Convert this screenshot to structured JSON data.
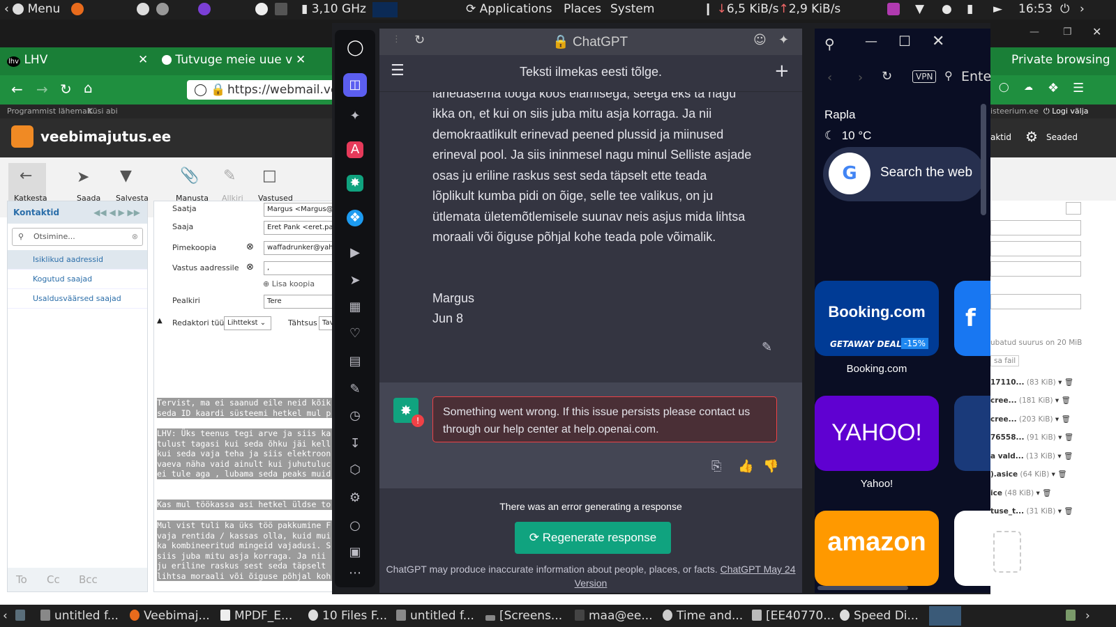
{
  "top_panel": {
    "menu": "Menu",
    "cpu": "3,10 GHz",
    "applications": "Applications",
    "places": "Places",
    "system": "System",
    "net_down": "6,5 KiB/s",
    "net_up": "2,9 KiB/s",
    "clock": "16:53"
  },
  "mail_browser": {
    "tabs": [
      "LHV",
      "Tutvuge meie uue v"
    ],
    "url": "https://webmail.ve",
    "private_browsing": "Private browsing",
    "topbar_links": [
      "Programmist lähemalt",
      "Küsi abi"
    ],
    "topbar_right": [
      "isteerium.ee",
      "Logi välja"
    ],
    "brand": "veebimajutus.ee",
    "brand_right": [
      "aktid",
      "Seaded"
    ],
    "toolbar": [
      "Katkesta",
      "Saada",
      "Salvesta",
      "Manusta",
      "Allkiri",
      "Vastused"
    ],
    "contacts": {
      "title": "Kontaktid",
      "search_placeholder": "Otsimine...",
      "items": [
        "Isiklikud aadressid",
        "Kogutud saajad",
        "Usaldusväärsed saajad"
      ],
      "bottom": [
        "To",
        "Cc",
        "Bcc"
      ]
    },
    "compose": {
      "fields": [
        {
          "label": "Saatja",
          "value": "Margus <Margus@"
        },
        {
          "label": "Saaja",
          "value": "Eret Pank <eret.pan"
        },
        {
          "label": "Pimekoopia",
          "value": "waffadrunker@yaho"
        },
        {
          "label": "Vastus aadressile",
          "value": ","
        },
        {
          "label": "Pealkiri",
          "value": "Tere"
        }
      ],
      "add_copy": "Lisa koopia",
      "editor_type_label": "Redaktori tüüp",
      "editor_type_value": "Lihttekst",
      "priority_label": "Tähtsus",
      "priority_value": "Tav",
      "body_blocks": [
        "Tervist, ma ei saanud eile neid kõik\nseda ID kaardi süsteemi hetkel mul p",
        "LHV: Üks teenus tegi arve ja siis ka\ntulust tagasi kui seda õhku jäi kell\nkui seda vaja teha ja siis elektroon\nvaeva näha vaid ainult kui juhutuluc\nei tule aga , lubama seda peaks muid",
        "Kas mul töökassa asi hetkel üldse to",
        "Mul vist tuli ka üks töö pakkumine F\nvaja rentida / kassas olla, kuid mui\nka kombineeritud mingeid vajadusi. S\nsiis juba mitu asja korraga. Ja nii\nju eriline raskus sest seda täpselt\nlihtsa moraali või õiguse põhjal koh"
      ]
    },
    "attachments": {
      "size_note": "ubatud suurus on 20 MiB",
      "attach_file": "sa fail",
      "files": [
        {
          "name": "17110...",
          "size": "(83 KiB)"
        },
        {
          "name": "cree...",
          "size": "(181 KiB)"
        },
        {
          "name": "cree...",
          "size": "(203 KiB)"
        },
        {
          "name": "76558...",
          "size": "(91 KiB)"
        },
        {
          "name": "a vald...",
          "size": "(13 KiB)"
        },
        {
          "name": ").asice",
          "size": "(64 KiB)"
        },
        {
          "name": "ice",
          "size": "(48 KiB)"
        },
        {
          "name": "tuse_t...",
          "size": "(31 KiB)"
        }
      ]
    }
  },
  "chatgpt": {
    "site": "ChatGPT",
    "title": "Teksti ilmekas eesti tõlge.",
    "message_lines": [
      "lähedasema tööga koos elamisega, seega eks ta nagu",
      "ikka on, et kui on siis juba mitu asja korraga. Ja nii",
      "demokraatlikult erinevad peened plussid ja miinused",
      "erineval pool. Ja siis ininmesel nagu minul Selliste asjade",
      "osas  ju eriline raskus sest seda täpselt ette teada",
      "lõplikult kumba pidi on õige, selle tee valikus, on ju",
      "ütlemata ületemõtlemisele suunav neis asjus mida lihtsa",
      "moraali või õiguse põhjal kohe teada pole võimalik."
    ],
    "signature_name": "Margus",
    "signature_date": "Jun 8",
    "error_message": "Something went wrong. If this issue persists please contact us through our help center at help.openai.com.",
    "error_generating": "There was an error generating a response",
    "regenerate": "Regenerate response",
    "disclaimer": "ChatGPT may produce inaccurate information about people, places, or facts.",
    "version_link": "ChatGPT May 24 Version"
  },
  "speed_dial": {
    "vpn": "VPN",
    "url_placeholder": "Ente",
    "weather_city": "Rapla",
    "weather_temp": "10 °C",
    "search_placeholder": "Search the web",
    "tiles": [
      {
        "label": "Booking.com",
        "logo": "Booking.com",
        "badge": "GETAWAY DEALS",
        "discount": "-15%"
      },
      {
        "label": "Yahoo!",
        "logo": "YAHOO!"
      },
      {
        "logo": "amazon"
      }
    ]
  },
  "taskbar": {
    "items": [
      "untitled f...",
      "Veebimaj...",
      "MPDF_E...",
      "10 Files F...",
      "untitled f...",
      "[Screens...",
      "maa@ee...",
      "Time and...",
      "[EE40770...",
      "Speed Di..."
    ]
  }
}
